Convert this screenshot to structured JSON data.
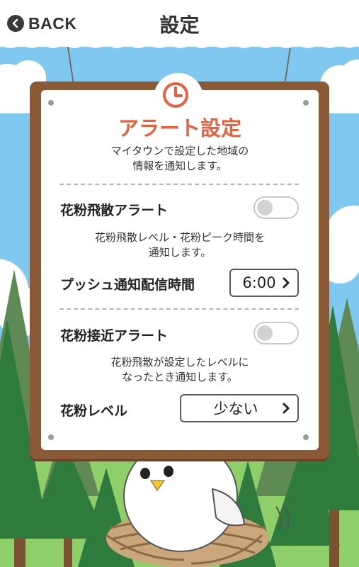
{
  "header": {
    "back_label": "BACK",
    "title": "設定"
  },
  "alert": {
    "title": "アラート設定",
    "description": "マイタウンで設定した地域の\n情報を通知します。",
    "icon": "clock-icon"
  },
  "pollen_alert": {
    "label": "花粉飛散アラート",
    "enabled": false,
    "description": "花粉飛散レベル・花粉ピーク時間を\n通知します。",
    "push_label": "プッシュ通知配信時間",
    "push_time": "6:00"
  },
  "approach_alert": {
    "label": "花粉接近アラート",
    "enabled": false,
    "description": "花粉飛散が設定したレベルに\nなったとき通知します。",
    "level_label": "花粉レベル",
    "level_value": "少ない"
  },
  "colors": {
    "accent": "#e8603c",
    "sky": "#7fc8ef",
    "board": "#8a5a36",
    "grass": "#8fcf6a"
  }
}
